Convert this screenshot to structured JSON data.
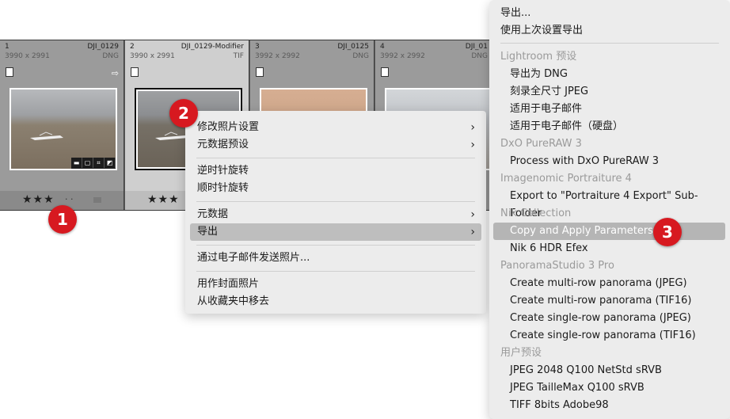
{
  "filmstrip": {
    "cells": [
      {
        "index": "1",
        "filename": "DJI_0129",
        "dimensions": "3990 x 2991",
        "format": "DNG",
        "stars": "★★★",
        "dots": "· ·"
      },
      {
        "index": "2",
        "filename": "DJI_0129-Modifier",
        "dimensions": "3990 x 2991",
        "format": "TIF",
        "stars": "★★★"
      },
      {
        "index": "3",
        "filename": "DJI_0125",
        "dimensions": "3992 x 2992",
        "format": "DNG"
      },
      {
        "index": "4",
        "filename": "DJI_01",
        "dimensions": "3992 x 2992",
        "format": "DNG"
      }
    ]
  },
  "context_menu": {
    "develop_settings": "修改照片设置",
    "metadata_presets": "元数据预设",
    "rotate_left": "逆时针旋转",
    "rotate_right": "顺时针旋转",
    "metadata": "元数据",
    "export": "导出",
    "email_photo": "通过电子邮件发送照片...",
    "set_cover": "用作封面照片",
    "remove_collection": "从收藏夹中移去"
  },
  "export_submenu": {
    "export_dots": "导出...",
    "export_previous": "使用上次设置导出",
    "lightroom_presets": "Lightroom 预设",
    "export_dng": "导出为 DNG",
    "burn_jpeg": "刻录全尺寸 JPEG",
    "for_email": "适用于电子邮件",
    "for_email_disk": "适用于电子邮件（硬盘）",
    "dxo_header": "DxO PureRAW 3",
    "dxo_process": "Process with DxO PureRAW 3",
    "imagenomic_header": "Imagenomic Portraiture 4",
    "imagenomic_export": "Export to \"Portraiture 4 Export\" Sub-Folder",
    "nik_header": "Nik Collection",
    "nik_copy": "Copy and Apply Parameters",
    "nik_hdr": "Nik 6 HDR Efex",
    "pano_header": "PanoramaStudio 3 Pro",
    "pano_multi_jpeg": "Create multi-row panorama (JPEG)",
    "pano_multi_tif": "Create multi-row panorama (TIF16)",
    "pano_single_jpeg": "Create single-row panorama (JPEG)",
    "pano_single_tif": "Create single-row panorama (TIF16)",
    "user_header": "用户预设",
    "user_jpeg2048": "JPEG 2048 Q100 NetStd sRVB",
    "user_taille": "JPEG TailleMax Q100 sRVB",
    "user_tiff": "TIFF 8bits Adobe98"
  },
  "callouts": {
    "one": "1",
    "two": "2",
    "three": "3"
  },
  "colors": {
    "callout": "#d71920",
    "menu_bg": "#ececec",
    "highlight": "#b5b5b5"
  }
}
